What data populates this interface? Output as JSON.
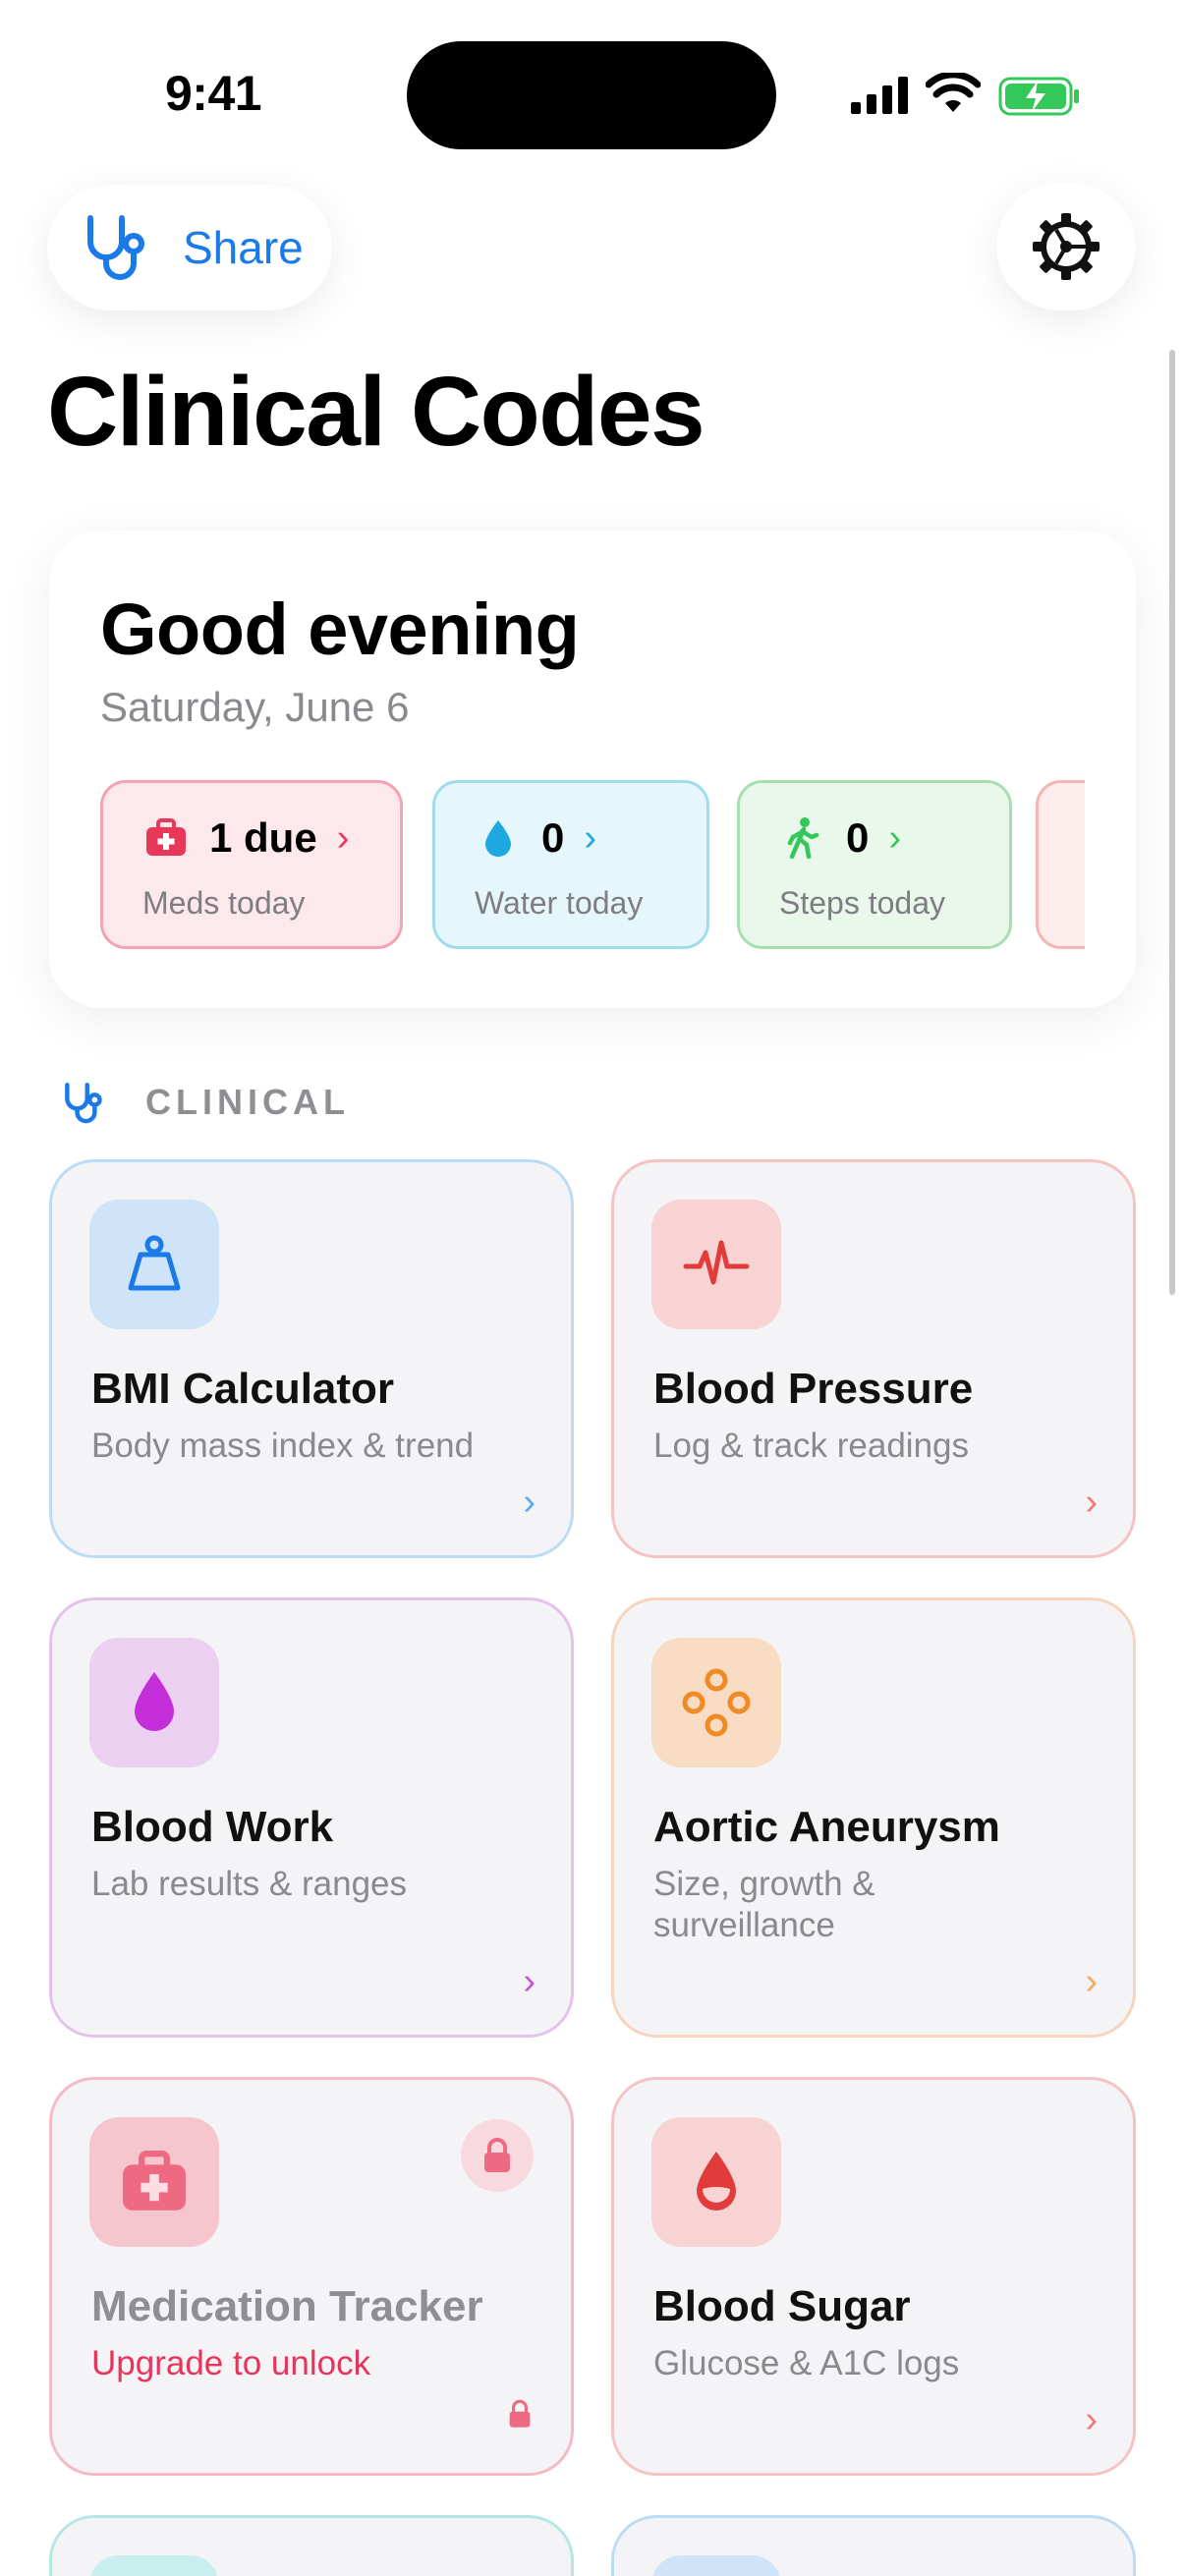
{
  "status_bar": {
    "time": "9:41"
  },
  "header": {
    "share_label": "Share",
    "title": "Clinical Codes"
  },
  "greeting": {
    "title": "Good evening",
    "date": "Saturday, June 6",
    "stats": [
      {
        "value": "1 due",
        "label": "Meds today",
        "icon": "medkit-icon",
        "color": "#e8385a"
      },
      {
        "value": "0",
        "label": "Water today",
        "icon": "water-drop-icon",
        "color": "#1ea8e0"
      },
      {
        "value": "0",
        "label": "Steps today",
        "icon": "walking-icon",
        "color": "#34c759"
      }
    ]
  },
  "section": {
    "label": "CLINICAL"
  },
  "tiles": [
    {
      "title": "BMI Calculator",
      "subtitle": "Body mass index & trend",
      "icon": "scale-weight-icon",
      "accent": "#5aa9f0"
    },
    {
      "title": "Blood Pressure",
      "subtitle": "Log & track readings",
      "icon": "heartbeat-icon",
      "accent": "#f07a7a"
    },
    {
      "title": "Blood Work",
      "subtitle": "Lab results & ranges",
      "icon": "drop-icon",
      "accent": "#c851d6"
    },
    {
      "title": "Aortic Aneurysm",
      "subtitle": "Size, growth & surveillance",
      "icon": "circles-icon",
      "accent": "#f5943a"
    },
    {
      "title": "Medication Tracker",
      "subtitle": "Upgrade to unlock",
      "icon": "medkit-icon",
      "accent": "#ee6a82",
      "locked": true
    },
    {
      "title": "Blood Sugar",
      "subtitle": "Glucose & A1C logs",
      "icon": "blood-drop-icon",
      "accent": "#e84a58"
    }
  ]
}
